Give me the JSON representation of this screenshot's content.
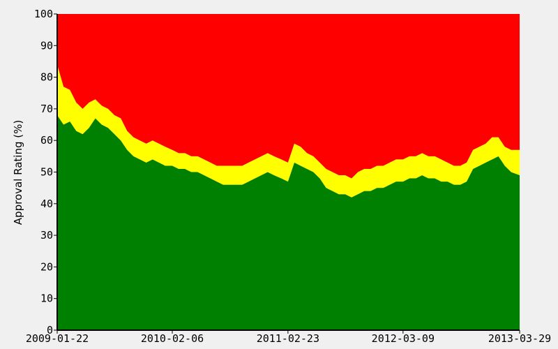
{
  "chart_data": {
    "type": "area",
    "stacked": true,
    "title": "",
    "xlabel": "",
    "ylabel": "Approval Rating (%)",
    "xlim": [
      "2009-01-22",
      "2013-03-29"
    ],
    "ylim": [
      0,
      100
    ],
    "x_ticks": [
      "2009-01-22",
      "2010-02-06",
      "2011-02-23",
      "2012-03-09",
      "2013-03-29"
    ],
    "y_ticks": [
      0,
      10,
      20,
      30,
      40,
      50,
      60,
      70,
      80,
      90,
      100
    ],
    "grid": false,
    "legend": "none",
    "x": [
      "2009-01-22",
      "2009-02-12",
      "2009-03-05",
      "2009-03-26",
      "2009-04-16",
      "2009-05-07",
      "2009-05-28",
      "2009-06-18",
      "2009-07-09",
      "2009-07-30",
      "2009-08-20",
      "2009-09-10",
      "2009-10-01",
      "2009-10-22",
      "2009-11-12",
      "2009-12-03",
      "2009-12-24",
      "2010-01-14",
      "2010-02-06",
      "2010-02-27",
      "2010-03-20",
      "2010-04-10",
      "2010-05-01",
      "2010-05-22",
      "2010-06-12",
      "2010-07-03",
      "2010-07-24",
      "2010-08-14",
      "2010-09-04",
      "2010-09-25",
      "2010-10-16",
      "2010-11-06",
      "2010-11-27",
      "2010-12-18",
      "2011-01-08",
      "2011-02-01",
      "2011-02-23",
      "2011-03-16",
      "2011-04-06",
      "2011-04-27",
      "2011-05-18",
      "2011-06-08",
      "2011-06-29",
      "2011-07-20",
      "2011-08-10",
      "2011-08-31",
      "2011-09-21",
      "2011-10-12",
      "2011-11-02",
      "2011-11-23",
      "2011-12-14",
      "2012-01-04",
      "2012-01-25",
      "2012-02-15",
      "2012-03-09",
      "2012-03-30",
      "2012-04-20",
      "2012-05-11",
      "2012-06-01",
      "2012-06-22",
      "2012-07-13",
      "2012-08-03",
      "2012-08-24",
      "2012-09-14",
      "2012-10-05",
      "2012-10-26",
      "2012-11-16",
      "2012-12-07",
      "2012-12-28",
      "2013-01-18",
      "2013-02-08",
      "2013-03-01",
      "2013-03-29"
    ],
    "series": [
      {
        "color": "#008000",
        "values": [
          68,
          65,
          66,
          63,
          62,
          64,
          67,
          65,
          64,
          62,
          60,
          57,
          55,
          54,
          53,
          54,
          53,
          52,
          52,
          51,
          51,
          50,
          50,
          49,
          48,
          47,
          46,
          46,
          46,
          46,
          47,
          48,
          49,
          50,
          49,
          48,
          47,
          53,
          52,
          51,
          50,
          48,
          45,
          44,
          43,
          43,
          42,
          43,
          44,
          44,
          45,
          45,
          46,
          47,
          47,
          48,
          48,
          49,
          48,
          48,
          47,
          47,
          46,
          46,
          47,
          51,
          52,
          53,
          54,
          55,
          52,
          50,
          49
        ]
      },
      {
        "color": "#ffff00",
        "values": [
          16,
          12,
          10,
          9,
          8,
          8,
          6,
          6,
          6,
          6,
          7,
          6,
          6,
          6,
          6,
          6,
          6,
          6,
          5,
          5,
          5,
          5,
          5,
          5,
          5,
          5,
          6,
          6,
          6,
          6,
          6,
          6,
          6,
          6,
          6,
          6,
          6,
          6,
          6,
          5,
          5,
          5,
          6,
          6,
          6,
          6,
          6,
          7,
          7,
          7,
          7,
          7,
          7,
          7,
          7,
          7,
          7,
          7,
          7,
          7,
          7,
          6,
          6,
          6,
          6,
          6,
          6,
          6,
          7,
          6,
          6,
          7,
          8
        ]
      },
      {
        "color": "#ff0000",
        "values": [
          16,
          23,
          24,
          28,
          30,
          28,
          27,
          29,
          30,
          32,
          33,
          37,
          39,
          40,
          41,
          40,
          41,
          42,
          43,
          44,
          44,
          45,
          45,
          46,
          47,
          48,
          48,
          48,
          48,
          48,
          47,
          46,
          45,
          44,
          45,
          46,
          47,
          41,
          42,
          44,
          45,
          47,
          49,
          50,
          51,
          51,
          52,
          50,
          49,
          49,
          48,
          48,
          47,
          46,
          46,
          45,
          45,
          44,
          45,
          45,
          46,
          47,
          48,
          48,
          47,
          43,
          42,
          41,
          39,
          39,
          42,
          43,
          43
        ]
      }
    ]
  }
}
